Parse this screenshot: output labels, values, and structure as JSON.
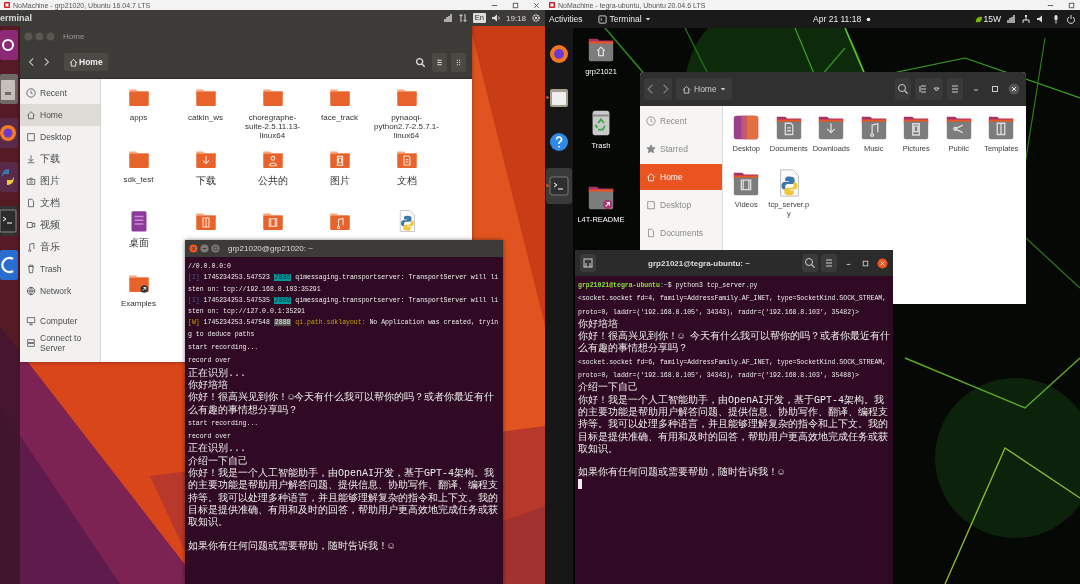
{
  "left_machine": {
    "title_bar": {
      "title": "NoMachine - grp21020, Ubuntu 16.04.7 LTS"
    },
    "top_bar": {
      "app": "erminal",
      "keyboard": "En",
      "clock": "19:18"
    },
    "file_manager": {
      "title": "Home",
      "path": "Home",
      "sidebar_sections": [
        {
          "items": [
            {
              "label": "Recent",
              "kind": "recent",
              "selected": false
            },
            {
              "label": "Home",
              "kind": "home",
              "selected": true
            },
            {
              "label": "Desktop",
              "kind": "desktop",
              "selected": false
            },
            {
              "label": "下载",
              "kind": "downloads",
              "selected": false
            },
            {
              "label": "图片",
              "kind": "pictures",
              "selected": false
            },
            {
              "label": "文档",
              "kind": "documents",
              "selected": false
            },
            {
              "label": "视频",
              "kind": "videos",
              "selected": false
            },
            {
              "label": "音乐",
              "kind": "music",
              "selected": false
            },
            {
              "label": "Trash",
              "kind": "trash",
              "selected": false
            },
            {
              "label": "Network",
              "kind": "network",
              "selected": false
            }
          ]
        },
        {
          "items": [
            {
              "label": "Computer",
              "kind": "computer",
              "selected": false
            },
            {
              "label": "Connect to Server",
              "kind": "server",
              "selected": false
            }
          ]
        }
      ],
      "items": [
        {
          "name": "apps",
          "kind": "folder"
        },
        {
          "name": "catkin_ws",
          "kind": "folder"
        },
        {
          "name": "choregraphe-suite-2.5.11.13-linux64",
          "kind": "folder"
        },
        {
          "name": "face_track",
          "kind": "folder"
        },
        {
          "name": "pynaoqi-python2.7-2.5.7.1-linux64",
          "kind": "folder"
        },
        {
          "name": "sdk_test",
          "kind": "folder"
        },
        {
          "name": "下载",
          "kind": "folder-download"
        },
        {
          "name": "公共的",
          "kind": "folder-person"
        },
        {
          "name": "图片",
          "kind": "folder-picture"
        },
        {
          "name": "文档",
          "kind": "folder-document"
        },
        {
          "name": "桌面",
          "kind": "launcher-file"
        },
        {
          "kind": "folder-template"
        },
        {
          "kind": "folder-video"
        },
        {
          "kind": "folder-music"
        },
        {
          "kind": "python-file"
        },
        {
          "name": "Examples",
          "kind": "folder-link"
        }
      ]
    },
    "terminal": {
      "title": "grp21020@grp21020: ~",
      "lines": [
        {
          "kind": "text",
          "text": "//0.0.0.0:0"
        },
        {
          "kind": "log",
          "warning": false,
          "tag": "[I]",
          "timestamp": "1745234253.547523",
          "pid": "2886",
          "source": "qimessaging.transportserver:",
          "message": "TransportServer will listen on: tcp://192.168.8.103:35291"
        },
        {
          "kind": "log",
          "warning": false,
          "tag": "[I]",
          "timestamp": "1745234253.547535",
          "pid": "2886",
          "source": "qimessaging.transportserver:",
          "message": "TransportServer will listen on: tcp://127.0.0.1:35291"
        },
        {
          "kind": "log",
          "warning": true,
          "tag": "[W]",
          "timestamp": "1745234253.547548",
          "pid": "2888",
          "source": "qi.path.sdklayout:",
          "message": "No Application was created, trying to deduce paths"
        },
        {
          "kind": "text",
          "text": "start recording..."
        },
        {
          "kind": "text",
          "text": "record over"
        },
        {
          "kind": "text",
          "text": "正在识别..."
        },
        {
          "kind": "text",
          "text": "你好培培"
        },
        {
          "kind": "text",
          "text": "你好！很高兴见到你！☺今天有什么我可以帮你的吗？或者你最近有什么有趣的事情想分享吗？"
        },
        {
          "kind": "text",
          "text": "start recording..."
        },
        {
          "kind": "text",
          "text": "record over"
        },
        {
          "kind": "text",
          "text": "正在识别..."
        },
        {
          "kind": "text",
          "text": "介绍一下自己"
        },
        {
          "kind": "text",
          "text": "你好！我是一个人工智能助手，由OpenAI开发，基于GPT-4架构。我的主要功能是帮助用户解答问题、提供信息、协助写作、翻译、编程支持等。我可以处理多种语言，并且能够理解复杂的指令和上下文。我的目标是提供准确、有用和及时的回答，帮助用户更高效地完成任务或获取知识。"
        },
        {
          "kind": "blank"
        },
        {
          "kind": "text",
          "text": "如果你有任何问题或需要帮助，随时告诉我！☺"
        }
      ]
    }
  },
  "right_machine": {
    "title_bar": {
      "title": "NoMachine - tegra-ubuntu, Ubuntu 20.04.6 LTS"
    },
    "top_bar": {
      "activities": "Activities",
      "app": "Terminal",
      "clock": "Apr 21  11:18",
      "power": "15W"
    },
    "dock": [
      {
        "kind": "browser",
        "running": false,
        "selected": false
      },
      {
        "kind": "files",
        "running": true,
        "selected": false
      },
      {
        "kind": "help",
        "running": false,
        "selected": false
      },
      {
        "kind": "terminal",
        "running": true,
        "selected": true
      }
    ],
    "desktop_icons": [
      {
        "label": "grp21021",
        "kind": "folder-home"
      },
      {
        "label": "Trash",
        "kind": "trash"
      },
      {
        "label": "L4T-README",
        "kind": "folder-link"
      }
    ],
    "file_manager": {
      "path": "Home",
      "sidebar": [
        {
          "label": "Recent",
          "kind": "recent",
          "selected": false
        },
        {
          "label": "Starred",
          "kind": "starred",
          "selected": false
        },
        {
          "label": "Home",
          "kind": "home",
          "selected": true
        },
        {
          "label": "Desktop",
          "kind": "desktop",
          "selected": false
        },
        {
          "label": "Documents",
          "kind": "documents",
          "selected": false
        }
      ],
      "items": [
        {
          "name": "Desktop",
          "kind": "gradient-folder"
        },
        {
          "name": "Documents",
          "kind": "folder-document"
        },
        {
          "name": "Downloads",
          "kind": "folder-download"
        },
        {
          "name": "Music",
          "kind": "folder-music"
        },
        {
          "name": "Pictures",
          "kind": "folder-picture"
        },
        {
          "name": "Public",
          "kind": "folder-share"
        },
        {
          "name": "Templates",
          "kind": "folder-template"
        },
        {
          "name": "Videos",
          "kind": "folder-video"
        },
        {
          "name": "tcp_server.py",
          "kind": "python-file"
        }
      ]
    },
    "terminal": {
      "title": "grp21021@tegra-ubuntu: ~",
      "lines": [
        {
          "kind": "prompt",
          "user": "grp21021@tegra-ubuntu",
          "path": ":~",
          "command": "$ python3 tcp_server.py"
        },
        {
          "kind": "text",
          "text": "<socket.socket fd=4, family=AddressFamily.AF_INET, type=SocketKind.SOCK_STREAM, proto=0, laddr=('192.168.8.105', 34343), raddr=('192.168.8.103', 35482)>"
        },
        {
          "kind": "text",
          "text": "你好培培"
        },
        {
          "kind": "text",
          "text": "你好！很高兴见到你！☺ 今天有什么我可以帮你的吗？或者你最近有什么有趣的事情想分享吗？"
        },
        {
          "kind": "text",
          "text": "<socket.socket fd=6, family=AddressFamily.AF_INET, type=SocketKind.SOCK_STREAM, proto=0, laddr=('192.168.8.105', 34343), raddr=('192.168.8.103', 35488)>"
        },
        {
          "kind": "text",
          "text": "介绍一下自己"
        },
        {
          "kind": "text",
          "text": "你好！我是一个人工智能助手，由OpenAI开发，基于GPT-4架构。我的主要功能是帮助用户解答问题、提供信息、协助写作、翻译、编程支持等。我可以处理多种语言，并且能够理解复杂的指令和上下文。我的目标是提供准确、有用和及时的回答，帮助用户更高效地完成任务或获取知识。"
        },
        {
          "kind": "blank"
        },
        {
          "kind": "text",
          "text": "如果你有任何问题或需要帮助，随时告诉我！☺"
        },
        {
          "kind": "cursor"
        }
      ]
    }
  }
}
